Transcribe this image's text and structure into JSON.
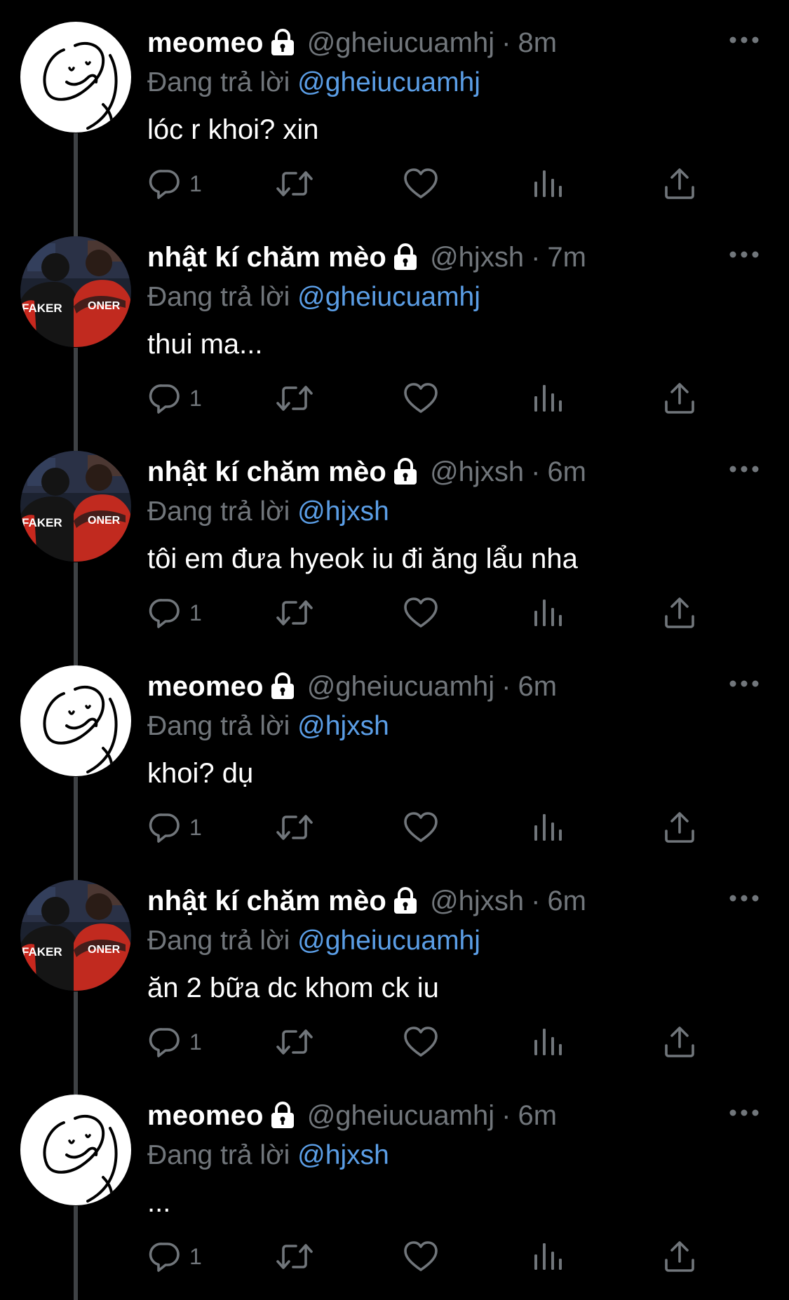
{
  "tweets": [
    {
      "avatar": "smiley-doodle",
      "display_name": "meomeo",
      "handle": "@gheiucuamhj",
      "dot": "·",
      "time": "8m",
      "reply_prefix": "Đang trả lời",
      "reply_to": "@gheiucuamhj",
      "text": "lóc r khoi? xin",
      "reply_count": "1"
    },
    {
      "avatar": "faker-oner-photo",
      "display_name": "nhật kí chăm mèo",
      "handle": "@hjxsh",
      "dot": "·",
      "time": "7m",
      "reply_prefix": "Đang trả lời",
      "reply_to": "@gheiucuamhj",
      "text": "thui ma...",
      "reply_count": "1"
    },
    {
      "avatar": "faker-oner-photo",
      "display_name": "nhật kí chăm mèo",
      "handle": "@hjxsh",
      "dot": "·",
      "time": "6m",
      "reply_prefix": "Đang trả lời",
      "reply_to": "@hjxsh",
      "text": "tôi em đưa hyeok iu đi ăng lẩu nha",
      "reply_count": "1"
    },
    {
      "avatar": "smiley-doodle",
      "display_name": "meomeo",
      "handle": "@gheiucuamhj",
      "dot": "·",
      "time": "6m",
      "reply_prefix": "Đang trả lời",
      "reply_to": "@hjxsh",
      "text": "khoi? dụ",
      "reply_count": "1"
    },
    {
      "avatar": "faker-oner-photo",
      "display_name": "nhật kí chăm mèo",
      "handle": "@hjxsh",
      "dot": "·",
      "time": "6m",
      "reply_prefix": "Đang trả lời",
      "reply_to": "@gheiucuamhj",
      "text": "ăn 2 bữa dc khom ck iu",
      "reply_count": "1"
    },
    {
      "avatar": "smiley-doodle",
      "display_name": "meomeo",
      "handle": "@gheiucuamhj",
      "dot": "·",
      "time": "6m",
      "reply_prefix": "Đang trả lời",
      "reply_to": "@hjxsh",
      "text": "...",
      "reply_count": "1"
    }
  ],
  "avatar_photo_labels": {
    "left_jersey": "FAKER",
    "right_jersey": "ONER"
  },
  "colors": {
    "background": "#000000",
    "secondary_text": "#71767b",
    "mention": "#5b9ee6",
    "thread_line": "#3e4144"
  },
  "icons": {
    "lock": "lock-icon",
    "more": "more-horizontal-icon",
    "reply": "reply-icon",
    "retweet": "retweet-icon",
    "like": "heart-icon",
    "views": "analytics-icon",
    "share": "share-icon"
  }
}
